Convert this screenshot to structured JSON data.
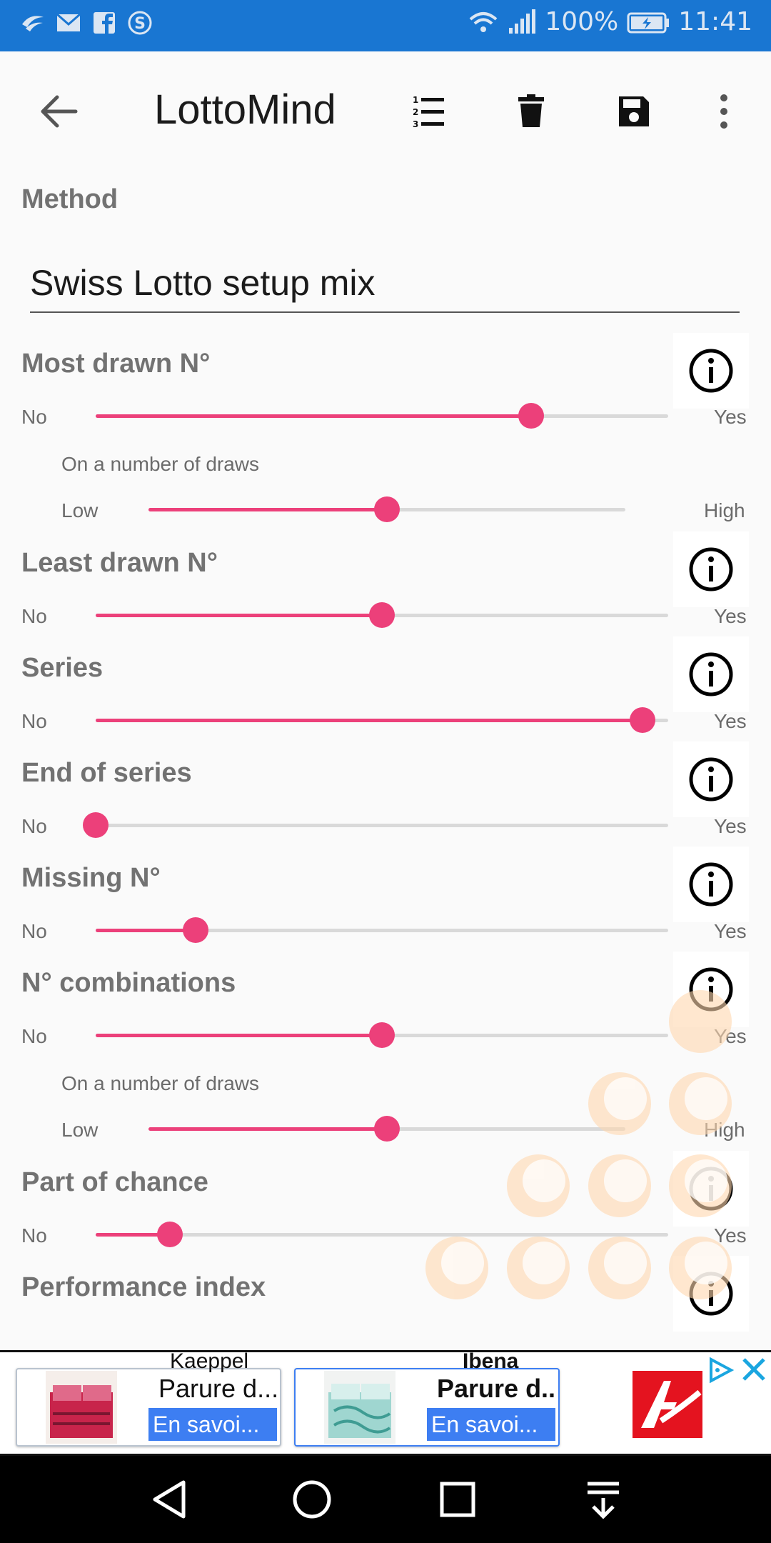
{
  "status_bar": {
    "battery_percent": "100%",
    "time": "11:41",
    "icons_left": [
      "swiftkey-icon",
      "mail-icon",
      "facebook-icon",
      "skype-icon"
    ],
    "icons_right": [
      "wifi-icon",
      "signal-icon",
      "battery-charging-icon"
    ]
  },
  "toolbar": {
    "title": "LottoMind",
    "actions": [
      "back-arrow-icon",
      "numbered-list-icon",
      "delete-icon",
      "save-icon",
      "more-vert-icon"
    ]
  },
  "method": {
    "label": "Method",
    "value": "Swiss Lotto setup mix"
  },
  "sections": [
    {
      "title": "Most drawn N°",
      "min": "No",
      "max": "Yes",
      "value": 0.76,
      "sub": {
        "label": "On a number of draws",
        "min": "Low",
        "max": "High",
        "value": 0.5
      }
    },
    {
      "title": "Least drawn N°",
      "min": "No",
      "max": "Yes",
      "value": 0.5
    },
    {
      "title": "Series",
      "min": "No",
      "max": "Yes",
      "value": 0.955
    },
    {
      "title": "End of series",
      "min": "No",
      "max": "Yes",
      "value": 0.0
    },
    {
      "title": "Missing N°",
      "min": "No",
      "max": "Yes",
      "value": 0.175
    },
    {
      "title": "N° combinations",
      "min": "No",
      "max": "Yes",
      "value": 0.5,
      "sub": {
        "label": "On a number of draws",
        "min": "Low",
        "max": "High",
        "value": 0.5
      }
    },
    {
      "title": "Part of chance",
      "min": "No",
      "max": "Yes",
      "value": 0.13
    },
    {
      "title": "Performance index"
    }
  ],
  "ad": {
    "cards": [
      {
        "brand": "Kaeppel",
        "text": "Parure d...",
        "button": "En savoi..."
      },
      {
        "brand": "Ibena",
        "text": "Parure d...",
        "button": "En savoi..."
      }
    ]
  },
  "colors": {
    "status_bar": "#1976d2",
    "accent": "#ec407a",
    "track": "#d9d9d9",
    "ad_button": "#3d7ef2",
    "ad_logo": "#e4131f"
  },
  "nav": [
    "back-triangle-icon",
    "home-circle-icon",
    "recents-square-icon",
    "notification-pull-icon"
  ]
}
